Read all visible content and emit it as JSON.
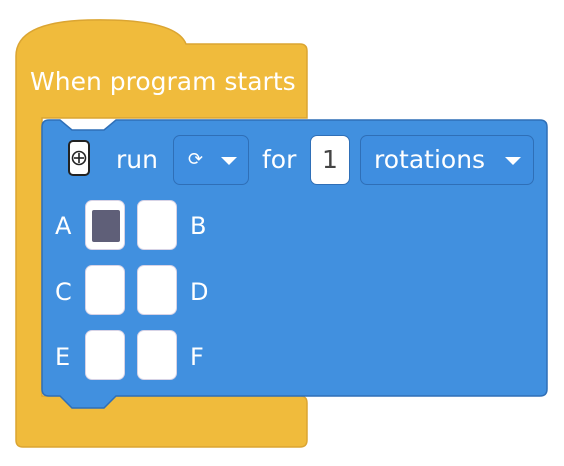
{
  "hat_block": {
    "label": "When program starts",
    "color": "#f0bb3c"
  },
  "motor_block": {
    "color": "#4190df",
    "icon": "motor-icon",
    "run_label": "run",
    "direction": {
      "glyph": "⟳",
      "icon": "clockwise-icon"
    },
    "for_label": "for",
    "amount": "1",
    "unit": "rotations",
    "ports": [
      {
        "label": "A",
        "selected": true
      },
      {
        "label": "B",
        "selected": false
      },
      {
        "label": "C",
        "selected": false
      },
      {
        "label": "D",
        "selected": false
      },
      {
        "label": "E",
        "selected": false
      },
      {
        "label": "F",
        "selected": false
      }
    ]
  }
}
